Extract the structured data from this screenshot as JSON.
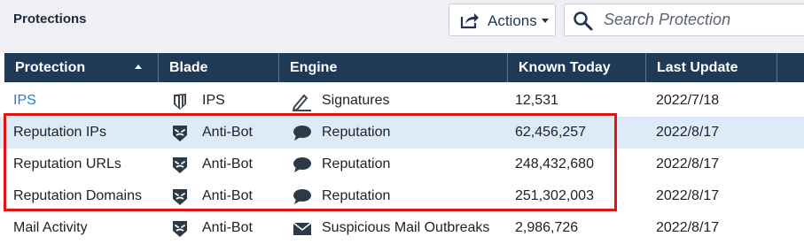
{
  "page": {
    "title": "Protections"
  },
  "toolbar": {
    "actions_label": "Actions",
    "actions_icon": "share-export-icon"
  },
  "search": {
    "placeholder": "Search Protection",
    "value": ""
  },
  "table": {
    "columns": [
      "Protection",
      "Blade",
      "Engine",
      "Known Today",
      "Last Update"
    ],
    "sorted_column": "Protection",
    "sort_direction": "ascending",
    "rows": [
      {
        "protection": "IPS",
        "blade": "IPS",
        "blade_icon": "ips-shield-icon",
        "engine": "Signatures",
        "engine_icon": "pen-ruler-icon",
        "known_today": "12,531",
        "last_update": "2022/7/18",
        "is_link": true,
        "selected": false
      },
      {
        "protection": "Reputation IPs",
        "blade": "Anti-Bot",
        "blade_icon": "anti-bot-shield-icon",
        "engine": "Reputation",
        "engine_icon": "speech-bubble-icon",
        "known_today": "62,456,257",
        "last_update": "2022/8/17",
        "is_link": false,
        "selected": true
      },
      {
        "protection": "Reputation URLs",
        "blade": "Anti-Bot",
        "blade_icon": "anti-bot-shield-icon",
        "engine": "Reputation",
        "engine_icon": "speech-bubble-icon",
        "known_today": "248,432,680",
        "last_update": "2022/8/17",
        "is_link": false,
        "selected": false
      },
      {
        "protection": "Reputation Domains",
        "blade": "Anti-Bot",
        "blade_icon": "anti-bot-shield-icon",
        "engine": "Reputation",
        "engine_icon": "speech-bubble-icon",
        "known_today": "251,302,003",
        "last_update": "2022/8/17",
        "is_link": false,
        "selected": false
      },
      {
        "protection": "Mail Activity",
        "blade": "Anti-Bot",
        "blade_icon": "anti-bot-shield-icon",
        "engine": "Suspicious Mail Outbreaks",
        "engine_icon": "envelope-icon",
        "known_today": "2,986,726",
        "last_update": "2022/8/17",
        "is_link": false,
        "selected": false
      }
    ]
  },
  "colors": {
    "header_bg": "#1f3a57",
    "selected_row": "#ddeaf7",
    "link": "#2a7bd3",
    "highlight_border": "#e01414"
  }
}
